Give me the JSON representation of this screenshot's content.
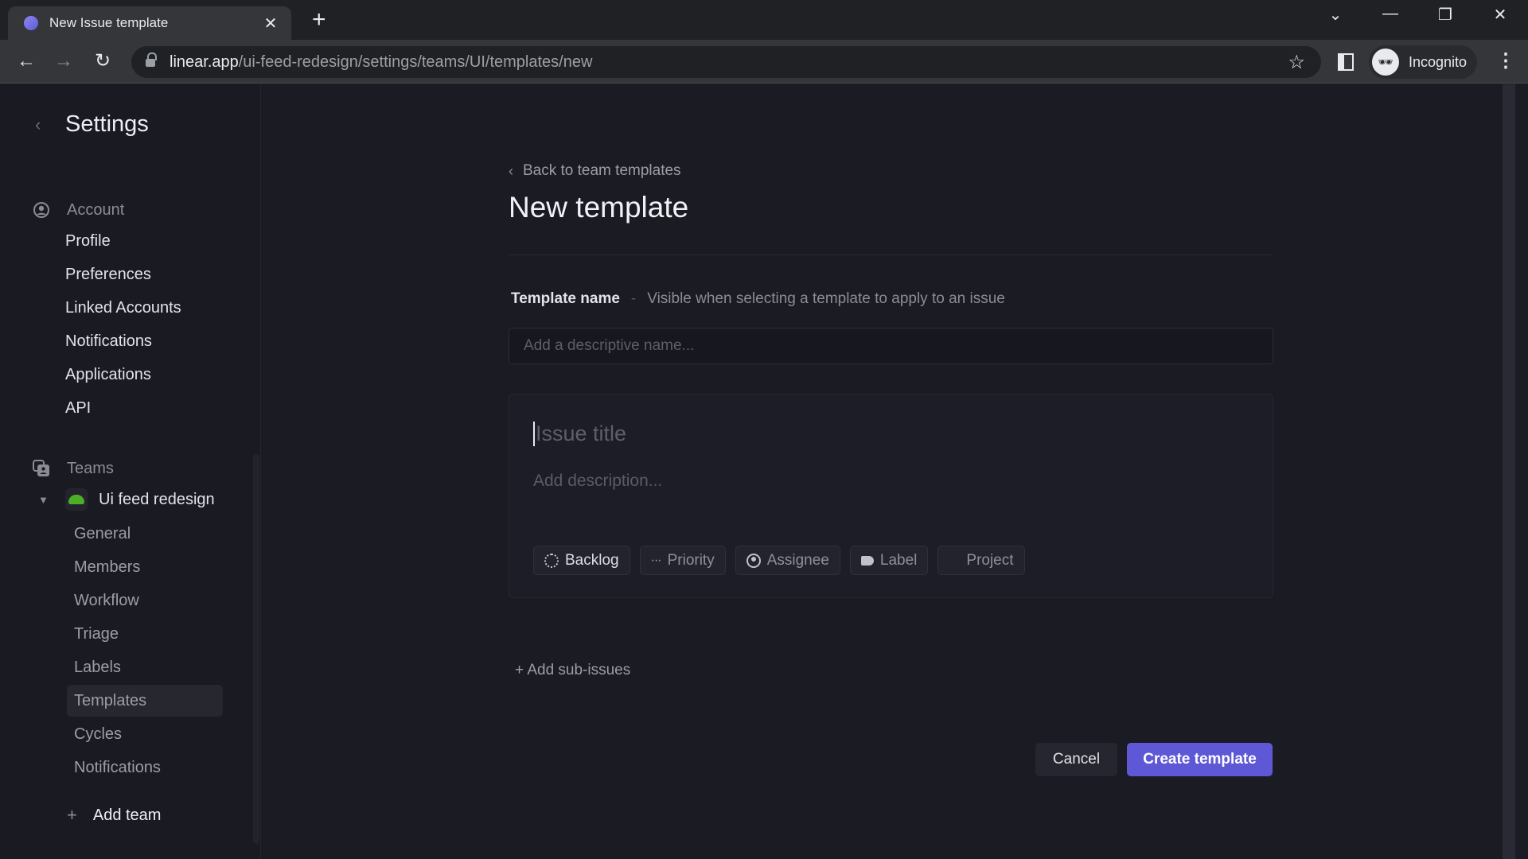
{
  "browser": {
    "tab_title": "New Issue template",
    "url_host": "linear.app",
    "url_path": "/ui-feed-redesign/settings/teams/UI/templates/new",
    "profile_label": "Incognito"
  },
  "sidebar": {
    "title": "Settings",
    "account_section": {
      "label": "Account",
      "items": [
        "Profile",
        "Preferences",
        "Linked Accounts",
        "Notifications",
        "Applications",
        "API"
      ]
    },
    "teams_section": {
      "label": "Teams",
      "team_name": "Ui feed redesign",
      "team_color": "#4cb027",
      "items": [
        "General",
        "Members",
        "Workflow",
        "Triage",
        "Labels",
        "Templates",
        "Cycles",
        "Notifications"
      ],
      "active_item": "Templates"
    },
    "add_team_label": "Add team"
  },
  "main": {
    "back_link": "Back to team templates",
    "page_title": "New template",
    "template_name_label": "Template name",
    "template_name_separator": "-",
    "template_name_hint": "Visible when selecting a template to apply to an issue",
    "template_name_value": "",
    "template_name_placeholder": "Add a descriptive name...",
    "issue_title_placeholder": "Issue title",
    "issue_description_placeholder": "Add description...",
    "chips": [
      {
        "label": "Backlog",
        "icon": "backlog-status-icon"
      },
      {
        "label": "Priority",
        "icon": "priority-icon"
      },
      {
        "label": "Assignee",
        "icon": "assignee-icon"
      },
      {
        "label": "Label",
        "icon": "label-tag-icon"
      },
      {
        "label": "Project",
        "icon": "project-grid-icon"
      }
    ],
    "add_sub_issues_label": "+ Add sub-issues",
    "cancel_label": "Cancel",
    "create_label": "Create template",
    "accent_color": "#5e58d6"
  }
}
